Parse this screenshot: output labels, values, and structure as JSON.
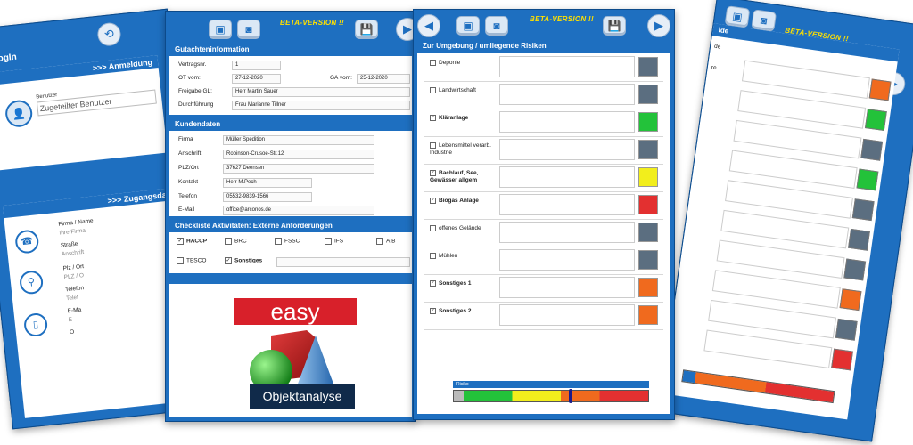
{
  "login_screen": {
    "title": "LogIn",
    "section_login": ">>> Anmeldung",
    "user_label": "Benutzer",
    "user_placeholder": "Zugeteilter Benutzer",
    "section_access": ">>> Zugangsda",
    "fields": {
      "firma": "Firma / Name",
      "firma_ph": "Ihre Firma",
      "strasse": "Straße",
      "strasse_ph": "Anschrift",
      "plz": "Plz / Ort",
      "plz_ph": "PLZ / O",
      "telefon": "Telefon",
      "telefon_ph": "Telef",
      "email": "E-Ma",
      "email_ph": "E",
      "extra": "O"
    }
  },
  "form_screen": {
    "beta": "BETA-VERSION !!",
    "gutachten": {
      "header": "Gutachteninformation",
      "vertragsnr_label": "Vertragsnr.",
      "vertragsnr": "1",
      "ot_label": "OT vom:",
      "ot": "27-12-2020",
      "ga_label": "GA vom:",
      "ga": "25-12-2020",
      "freigabe_label": "Freigabe GL:",
      "freigabe": "Herr Martin Sauer",
      "durchfuehrung_label": "Durchführung",
      "durchfuehrung": "Frau Marianne Tillner"
    },
    "kunde": {
      "header": "Kundendaten",
      "firma_label": "Firma",
      "firma": "Müller Spedition",
      "anschrift_label": "Anschrift",
      "anschrift": "Robinson-Crusoe-Str.12",
      "plz_label": "PLZ/Ort",
      "plz": "37627 Deensen",
      "kontakt_label": "Kontakt",
      "kontakt": "Herr M.Pech",
      "telefon_label": "Telefon",
      "telefon": "05532-9839-1566",
      "email_label": "E-Mail",
      "email": "office@arconos.de"
    },
    "checklist": {
      "header": "Checkliste Aktivitäten: Externe Anforderungen",
      "items": [
        {
          "label": "HACCP",
          "checked": true
        },
        {
          "label": "BRC",
          "checked": false
        },
        {
          "label": "FSSC",
          "checked": false
        },
        {
          "label": "IFS",
          "checked": false
        },
        {
          "label": "AIB",
          "checked": false
        },
        {
          "label": "TESCO",
          "checked": false
        },
        {
          "label": "Sonstiges",
          "checked": true
        }
      ]
    },
    "logo_word": "easy",
    "logo_caption": "Objektanalyse"
  },
  "risk_screen": {
    "beta": "BETA-VERSION !!",
    "header": "Zur Umgebung / umliegende Risiken",
    "rows": [
      {
        "label": "Deponie",
        "checked": false,
        "color": "#5b6e80"
      },
      {
        "label": "Landwirtschaft",
        "checked": false,
        "color": "#5b6e80"
      },
      {
        "label": "Kläranlage",
        "checked": true,
        "color": "#23c23a"
      },
      {
        "label": "Lebensmittel verarb. Industrie",
        "checked": false,
        "color": "#5b6e80"
      },
      {
        "label": "Bachlauf, See, Gewässer allgem",
        "checked": true,
        "color": "#f2ee1c"
      },
      {
        "label": "Biogas Anlage",
        "checked": true,
        "color": "#e33030"
      },
      {
        "label": "offenes Gelände",
        "checked": false,
        "color": "#5b6e80"
      },
      {
        "label": "Mühlen",
        "checked": false,
        "color": "#5b6e80"
      },
      {
        "label": "Sonstiges 1",
        "checked": true,
        "color": "#f06a1e"
      },
      {
        "label": "Sonstiges 2",
        "checked": true,
        "color": "#f06a1e"
      }
    ],
    "risk_label": "Risiko",
    "risk_level": 0.6
  },
  "right_screen": {
    "beta": "BETA-VERSION !!",
    "header_fragment": "ide",
    "row_frag_1": "de",
    "row_frag_2": "re",
    "swatches": [
      "#f06a1e",
      "#23c23a",
      "#5b6e80",
      "#23c23a",
      "#5b6e80",
      "#5b6e80",
      "#5b6e80",
      "#f06a1e",
      "#5b6e80",
      "#e33030"
    ]
  },
  "icons": {
    "refresh": "⟲",
    "back": "◀",
    "forward": "▶",
    "save": "💾",
    "image": "▣",
    "camera": "◙"
  }
}
